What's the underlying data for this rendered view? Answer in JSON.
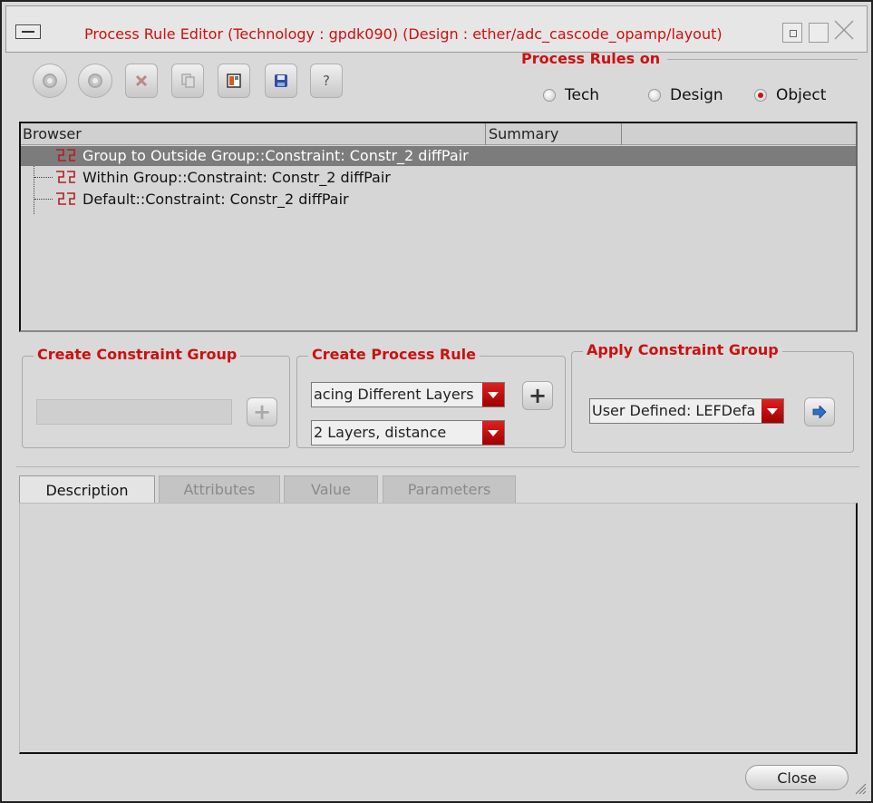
{
  "window": {
    "title": "Process Rule Editor (Technology : gpdk090) (Design : ether/adc_cascode_opamp/layout)"
  },
  "toolbar": {
    "buttons": [
      {
        "icon": "gear-icon"
      },
      {
        "icon": "gear-icon"
      },
      {
        "icon": "delete-icon"
      },
      {
        "icon": "copy-icon"
      },
      {
        "icon": "open-icon"
      },
      {
        "icon": "save-icon"
      },
      {
        "icon": "help-icon",
        "label": "?"
      }
    ]
  },
  "process_rules_on": {
    "title": "Process Rules on",
    "options": [
      {
        "label": "Tech",
        "selected": false
      },
      {
        "label": "Design",
        "selected": false
      },
      {
        "label": "Object",
        "selected": true
      }
    ]
  },
  "browser": {
    "columns": [
      "Browser",
      "Summary"
    ],
    "rows": [
      {
        "label": "Group to Outside Group::Constraint: Constr_2 diffPair",
        "selected": true
      },
      {
        "label": "Within Group::Constraint: Constr_2 diffPair",
        "selected": false
      },
      {
        "label": "Default::Constraint: Constr_2 diffPair",
        "selected": false
      }
    ]
  },
  "create_constraint_group": {
    "title": "Create Constraint Group",
    "input_value": "",
    "add_label": "+"
  },
  "create_process_rule": {
    "title": "Create Process Rule",
    "rule_value": "acing Different Layers",
    "type_value": "2 Layers, distance",
    "add_label": "+"
  },
  "apply_constraint_group": {
    "title": "Apply Constraint Group",
    "value": "User Defined: LEFDefa"
  },
  "tabs": [
    {
      "label": "Description",
      "active": true
    },
    {
      "label": "Attributes",
      "active": false
    },
    {
      "label": "Value",
      "active": false
    },
    {
      "label": "Parameters",
      "active": false
    }
  ],
  "footer": {
    "close_label": "Close"
  },
  "colors": {
    "accent_red": "#cc1010",
    "selection": "#7c7c7c",
    "background": "#d9d9d9"
  }
}
